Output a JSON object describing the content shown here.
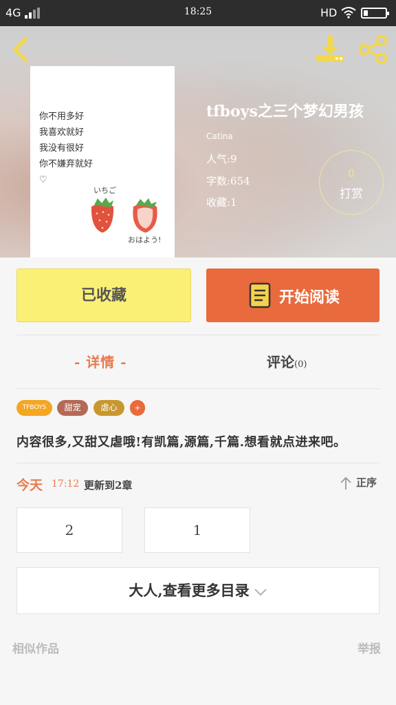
{
  "status_bar": {
    "network": "4G",
    "time": "18:25",
    "hd": "HD"
  },
  "book": {
    "title": "tfboys之三个梦幻男孩",
    "author": "Catina",
    "popularity": "人气:9",
    "word_count": "字数:654",
    "favorites": "收藏:1",
    "tip_count": "0",
    "tip_label": "打赏",
    "cover": {
      "lines": [
        "你不用多好",
        "我喜欢就好",
        "我没有很好",
        "你不嫌弃就好",
        "♡"
      ],
      "caption_top": "いちご",
      "caption_bottom": "おはよう!"
    }
  },
  "actions": {
    "favorited_label": "已收藏",
    "read_label": "开始阅读"
  },
  "tabs": {
    "detail": "- 详情 -",
    "comment": "评论",
    "comment_count": "(0)"
  },
  "tags": [
    {
      "label": "TFBOYS",
      "color": "#f5a623"
    },
    {
      "label": "甜宠",
      "color": "#b56a56"
    },
    {
      "label": "虐心",
      "color": "#c9972f"
    },
    {
      "label": "+",
      "color": "#e96a3d"
    }
  ],
  "description": "内容很多,又甜又虐哦!有凯篇,源篇,千篇.想看就点进来吧。",
  "update": {
    "day": "今天",
    "time": "17:12",
    "chapter": "更新到2章",
    "order_label": "正序"
  },
  "chapters": [
    "2",
    "1"
  ],
  "more_label": "大人,查看更多目录",
  "footer": {
    "similar": "相似作品",
    "report": "举报"
  },
  "colors": {
    "accent": "#e96a3d",
    "favorite_bg": "#fbf076",
    "tip_number": "#f3e28a"
  }
}
